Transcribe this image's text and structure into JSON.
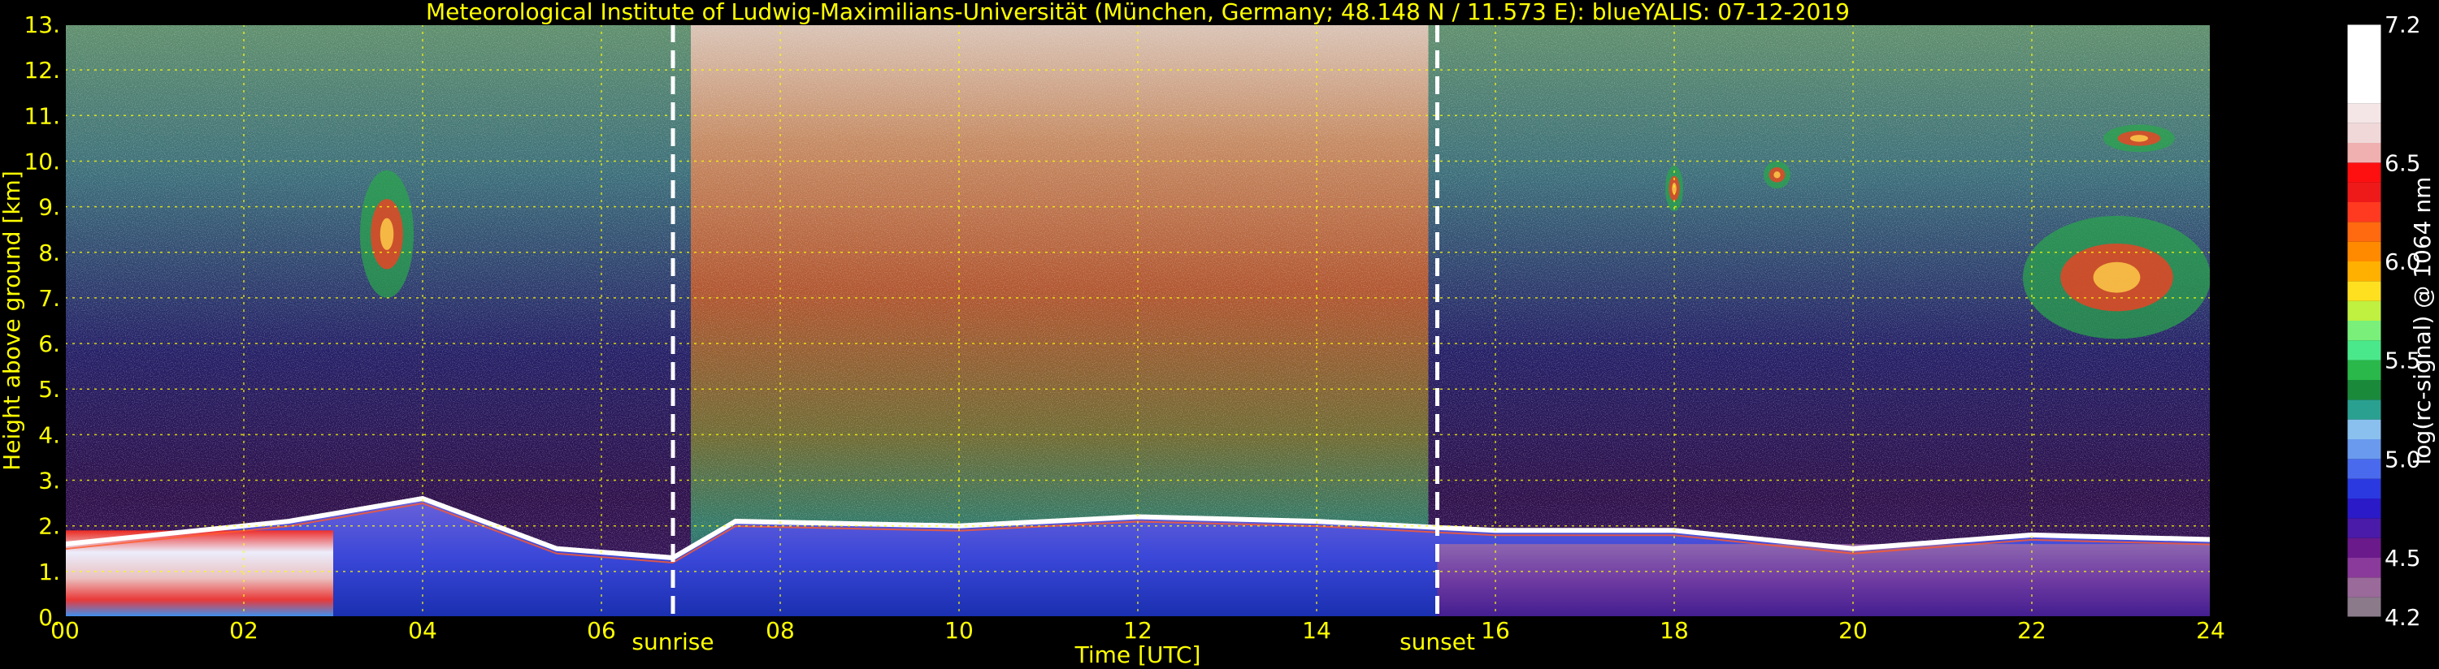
{
  "chart_data": {
    "type": "heatmap",
    "title": "Meteorological Institute of Ludwig-Maximilians-Universität (München, Germany; 48.148 N / 11.573 E):    blueYALIS: 07-12-2019",
    "xlabel": "Time [UTC]",
    "ylabel": "Height above ground [km]",
    "xlim": [
      0,
      24
    ],
    "ylim": [
      0,
      13
    ],
    "x_ticks": [
      "00",
      "02",
      "04",
      "06",
      "08",
      "10",
      "12",
      "14",
      "16",
      "18",
      "20",
      "22",
      "24"
    ],
    "y_ticks": [
      "0.",
      "1.",
      "2.",
      "3.",
      "4.",
      "5.",
      "6.",
      "7.",
      "8.",
      "9.",
      "10.",
      "11.",
      "12.",
      "13."
    ],
    "grid": true,
    "markers": [
      {
        "label": "sunrise",
        "x": 6.8
      },
      {
        "label": "sunset",
        "x": 15.35
      }
    ],
    "colorbar": {
      "label": "log(rc-signal) @ 1064 nm",
      "range": [
        4.2,
        7.2
      ],
      "ticks": [
        "4.2",
        "4.5",
        "5.0",
        "5.5",
        "6.0",
        "6.5",
        "7.2"
      ]
    },
    "features": {
      "boundary_layer_top_km": [
        {
          "x": 0.0,
          "y": 1.6
        },
        {
          "x": 2.5,
          "y": 2.1
        },
        {
          "x": 4.0,
          "y": 2.6
        },
        {
          "x": 5.5,
          "y": 1.5
        },
        {
          "x": 6.8,
          "y": 1.3
        },
        {
          "x": 7.5,
          "y": 2.1
        },
        {
          "x": 10.0,
          "y": 2.0
        },
        {
          "x": 12.0,
          "y": 2.2
        },
        {
          "x": 14.0,
          "y": 2.1
        },
        {
          "x": 16.0,
          "y": 1.9
        },
        {
          "x": 18.0,
          "y": 1.9
        },
        {
          "x": 20.0,
          "y": 1.5
        },
        {
          "x": 22.0,
          "y": 1.8
        },
        {
          "x": 24.0,
          "y": 1.7
        }
      ],
      "cirrus_patches": [
        {
          "x0": 3.3,
          "x1": 3.9,
          "y0": 7.0,
          "y1": 9.8
        },
        {
          "x0": 17.9,
          "x1": 18.1,
          "y0": 8.9,
          "y1": 9.9
        },
        {
          "x0": 19.0,
          "x1": 19.3,
          "y0": 9.4,
          "y1": 10.0
        },
        {
          "x0": 21.9,
          "x1": 24.0,
          "y0": 6.1,
          "y1": 8.8
        },
        {
          "x0": 22.8,
          "x1": 23.6,
          "y0": 10.2,
          "y1": 10.8
        }
      ]
    }
  }
}
